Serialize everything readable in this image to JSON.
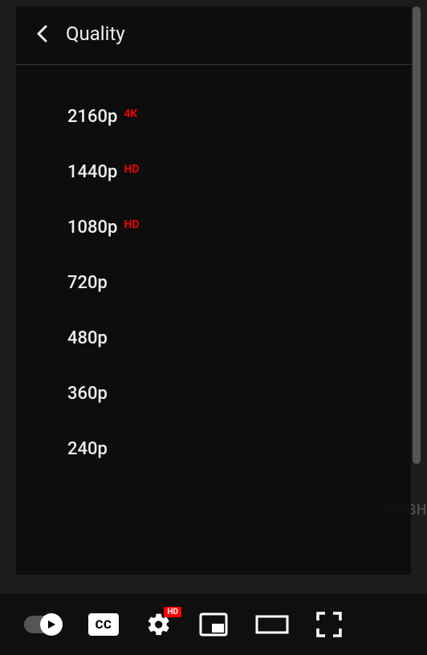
{
  "menu": {
    "title": "Quality",
    "items": [
      {
        "label": "2160p",
        "badge": "4K"
      },
      {
        "label": "1440p",
        "badge": "HD"
      },
      {
        "label": "1080p",
        "badge": "HD"
      },
      {
        "label": "720p",
        "badge": ""
      },
      {
        "label": "480p",
        "badge": ""
      },
      {
        "label": "360p",
        "badge": ""
      },
      {
        "label": "240p",
        "badge": ""
      }
    ]
  },
  "controls": {
    "cc_label": "CC",
    "settings_badge": "HD"
  },
  "watermark": "MKBH"
}
